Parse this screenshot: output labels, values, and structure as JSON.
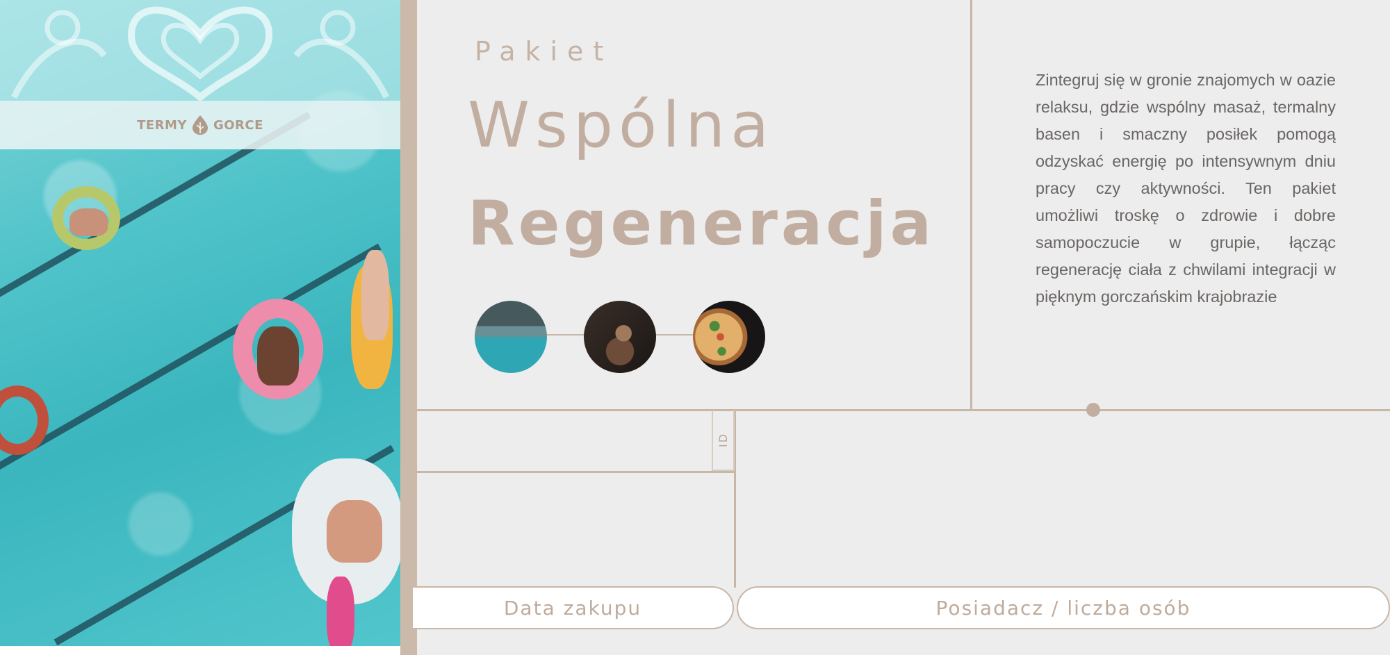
{
  "brand": {
    "logo_left": "TERMY",
    "logo_right": "GORCE"
  },
  "header": {
    "label": "Pakiet",
    "title_light": "Wspólna",
    "title_bold": "Regeneracja"
  },
  "description": "Zintegruj się w gronie znajomych w oazie relaksu, gdzie wspólny masaż, termalny basen i smaczny posiłek pomogą odzyskać energię po intensywnym dniu pracy czy aktywności. Ten pakiet umożliwi troskę o zdrowie i dobre samopoczucie w grupie, łącząc regenerację ciała z chwilami integracji w pięknym gorczańskim krajobrazie",
  "thumbnails": [
    "pool-photo",
    "relax-photo",
    "pizza-photo"
  ],
  "id_label": "ID",
  "fields": {
    "purchase_date": "Data zakupu",
    "holder": "Posiadacz / liczba osób"
  },
  "colors": {
    "accent": "#c2aea0",
    "background": "#ededee",
    "line": "#c8b6a6",
    "text": "#6a6663"
  }
}
